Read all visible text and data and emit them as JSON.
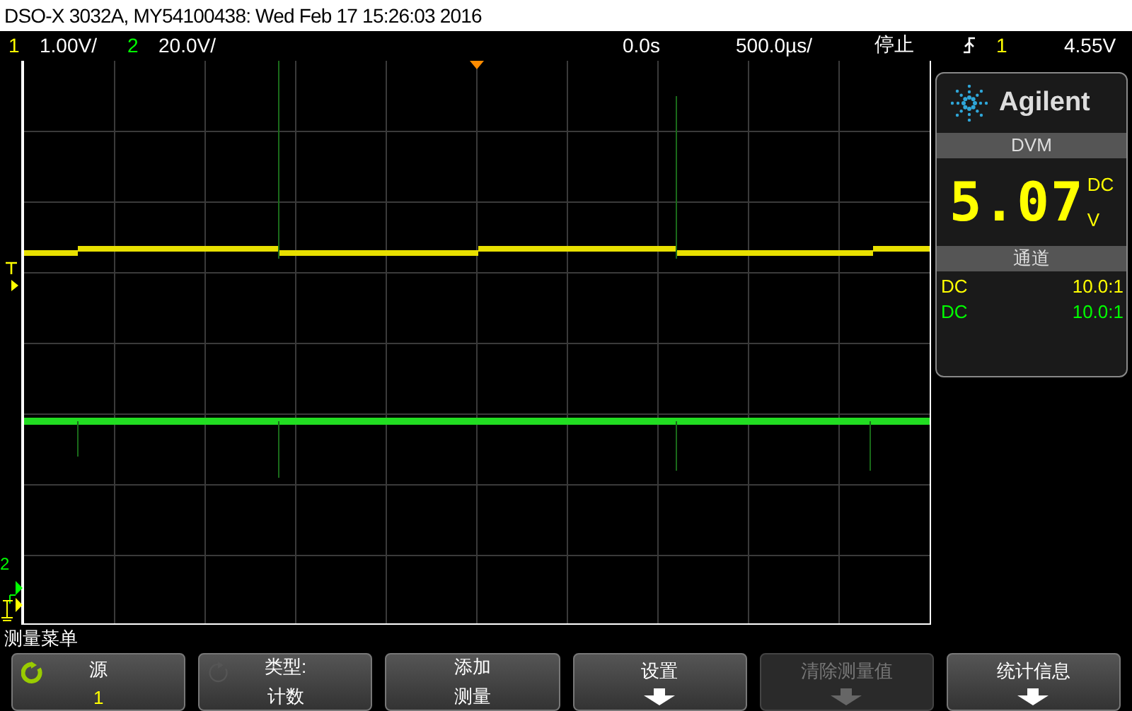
{
  "window": {
    "title": "DSO-X 3032A, MY54100438: Wed Feb 17 15:26:03 2016"
  },
  "status_bar": {
    "channels": [
      {
        "number": "1",
        "scale": "1.00V/",
        "color": "#ffff00"
      },
      {
        "number": "2",
        "scale": "20.0V/",
        "color": "#00ff00"
      }
    ],
    "time_offset": "0.0s",
    "timebase": "500.0µs/",
    "run_state": "停止",
    "trigger": {
      "channel": "1",
      "level": "4.55V"
    }
  },
  "ground_marker": {
    "label": "2",
    "color": "#00ff00"
  },
  "panel": {
    "brand": "Agilent",
    "dvm": {
      "header": "DVM",
      "reading": "5.07",
      "coupling": "DC",
      "unit": "V"
    },
    "channels_header": "通道",
    "channels": [
      {
        "coupling": "DC",
        "probe": "10.0:1",
        "color": "#ffff00"
      },
      {
        "coupling": "DC",
        "probe": "10.0:1",
        "color": "#00ff00"
      }
    ]
  },
  "menu": {
    "title": "测量菜单",
    "softkeys": [
      {
        "kind": "knob",
        "label": "源",
        "value": "1",
        "knob_active": true,
        "disabled": false
      },
      {
        "kind": "knob",
        "label": "类型:",
        "value": "计数",
        "knob_active": false,
        "disabled": false
      },
      {
        "kind": "text",
        "label": "添加",
        "value": "测量",
        "disabled": false
      },
      {
        "kind": "submenu",
        "label": "设置",
        "disabled": false
      },
      {
        "kind": "submenu",
        "label": "清除测量值",
        "disabled": true
      },
      {
        "kind": "submenu",
        "label": "统计信息",
        "disabled": false
      }
    ]
  }
}
